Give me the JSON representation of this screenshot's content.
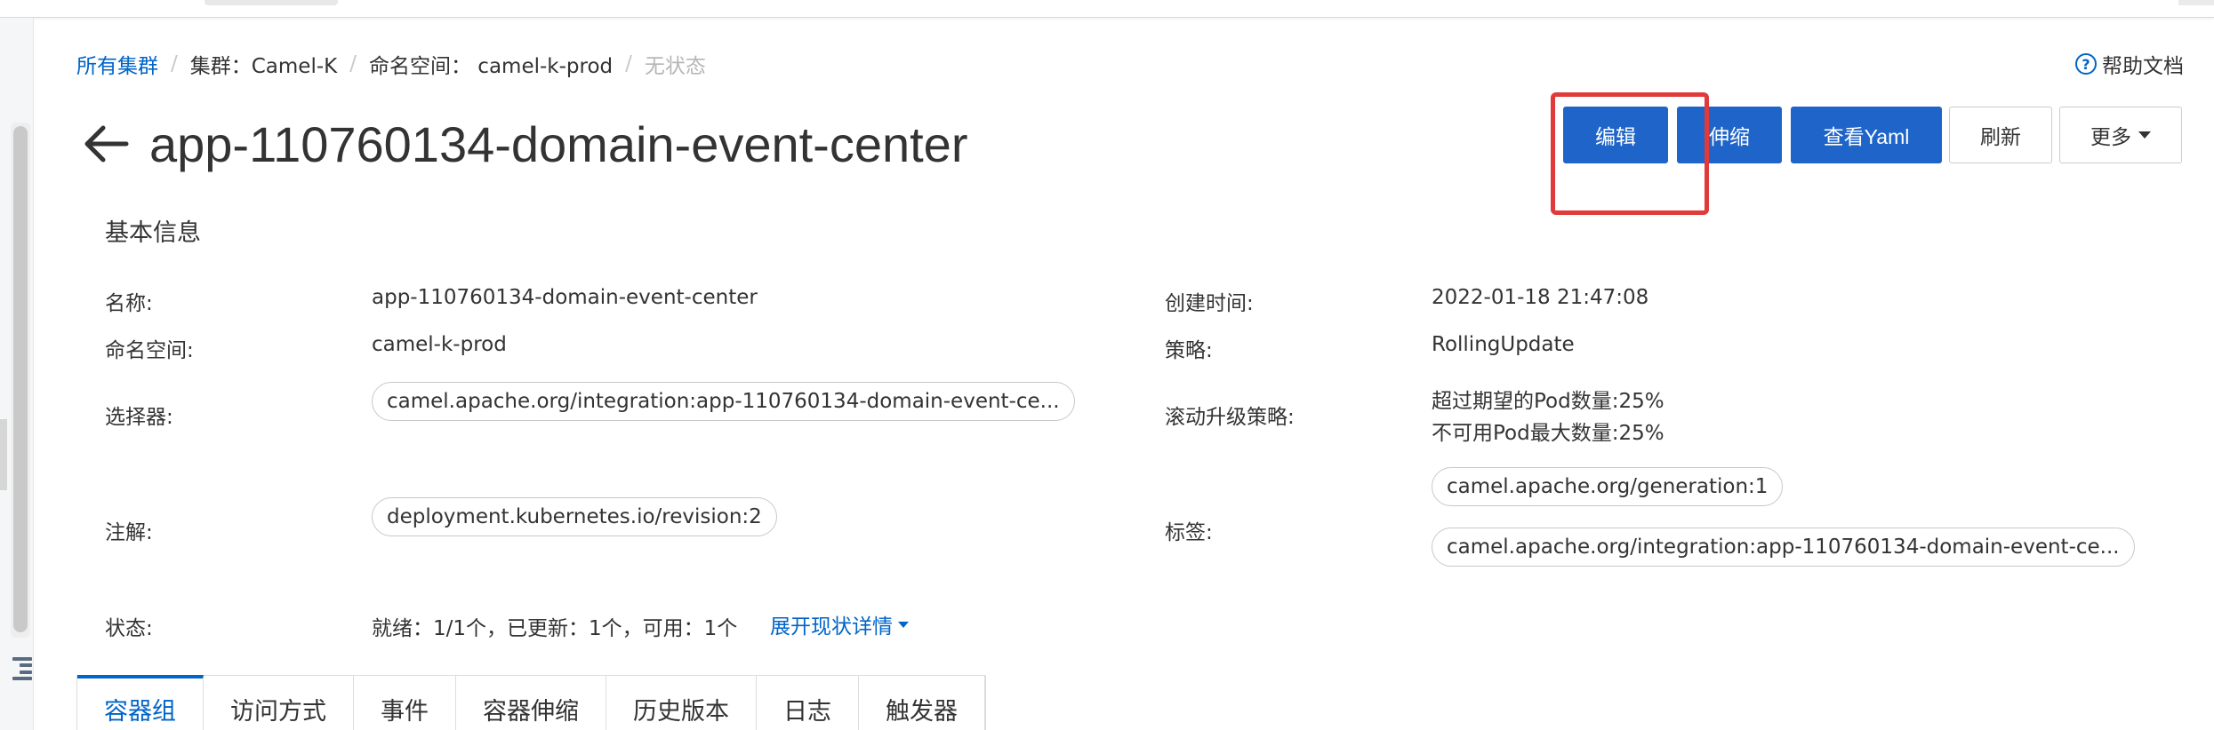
{
  "breadcrumb": {
    "all_clusters": "所有集群",
    "cluster": "集群：Camel-K",
    "namespace": "命名空间： camel-k-prod",
    "current": "无状态"
  },
  "help": {
    "label": "帮助文档",
    "icon": "question-circle-icon"
  },
  "page": {
    "title": "app-110760134-domain-event-center"
  },
  "actions": {
    "edit": "编辑",
    "scale": "伸缩",
    "view_yaml": "查看Yaml",
    "refresh": "刷新",
    "more": "更多"
  },
  "basic_info": {
    "section_title": "基本信息",
    "name_label": "名称:",
    "name_value": "app-110760134-domain-event-center",
    "namespace_label": "命名空间:",
    "namespace_value": "camel-k-prod",
    "selector_label": "选择器:",
    "selector_tag": "camel.apache.org/integration:app-110760134-domain-event-ce...",
    "annotation_label": "注解:",
    "annotation_tag": "deployment.kubernetes.io/revision:2",
    "status_label": "状态:",
    "status_value": "就绪：1/1个，已更新：1个，可用：1个",
    "status_expand": "展开现状详情",
    "created_label": "创建时间:",
    "created_value": "2022-01-18 21:47:08",
    "strategy_label": "策略:",
    "strategy_value": "RollingUpdate",
    "rolling_label": "滚动升级策略:",
    "rolling_max_surge": "超过期望的Pod数量:25%",
    "rolling_max_unavailable": "不可用Pod最大数量:25%",
    "labels_label": "标签:",
    "labels_tags": [
      "camel.apache.org/generation:1",
      "camel.apache.org/integration:app-110760134-domain-event-ce..."
    ]
  },
  "tabs": [
    "容器组",
    "访问方式",
    "事件",
    "容器伸缩",
    "历史版本",
    "日志",
    "触发器"
  ],
  "colors": {
    "primary": "#1f64c8",
    "link": "#0064c8",
    "highlight": "#e03a3a"
  }
}
